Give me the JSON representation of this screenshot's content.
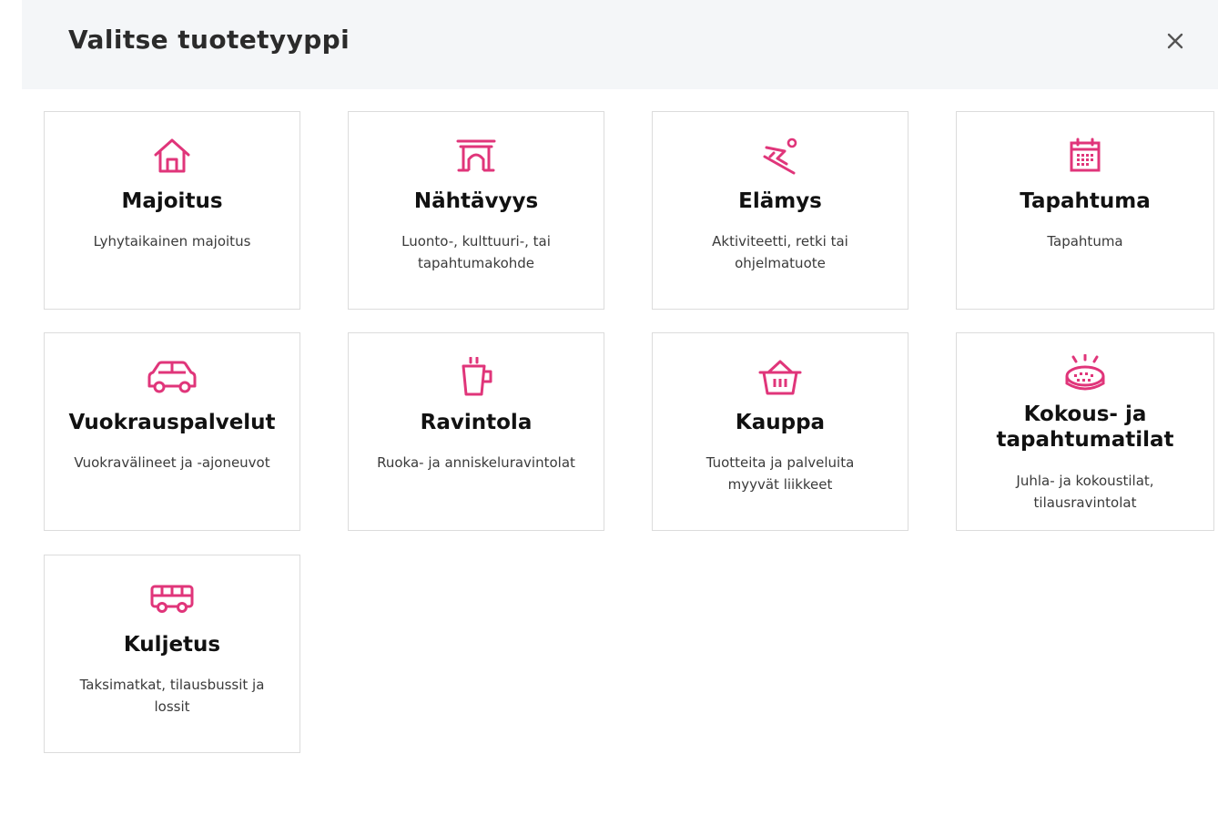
{
  "modal": {
    "title": "Valitse tuotetyyppi"
  },
  "colors": {
    "accent": "#e0357a",
    "header_bg": "#f4f6f8",
    "card_border": "#dcdcdc"
  },
  "cards": [
    {
      "icon": "house-icon",
      "title": "Majoitus",
      "desc": "Lyhytaikainen majoitus"
    },
    {
      "icon": "gate-icon",
      "title": "Nähtävyys",
      "desc": "Luonto-, kulttuuri-, tai tapahtumakohde"
    },
    {
      "icon": "skier-icon",
      "title": "Elämys",
      "desc": "Aktiviteetti, retki tai ohjelmatuote"
    },
    {
      "icon": "calendar-icon",
      "title": "Tapahtuma",
      "desc": "Tapahtuma"
    },
    {
      "icon": "car-icon",
      "title": "Vuokrauspalvelut",
      "desc": "Vuokravälineet ja -ajoneuvot"
    },
    {
      "icon": "coffee-cup-icon",
      "title": "Ravintola",
      "desc": "Ruoka- ja anniskeluravintolat"
    },
    {
      "icon": "shopping-basket-icon",
      "title": "Kauppa",
      "desc": "Tuotteita ja palveluita myyvät liikkeet"
    },
    {
      "icon": "stadium-icon",
      "title": "Kokous- ja tapahtumatilat",
      "desc": "Juhla- ja kokoustilat, tilausravintolat"
    },
    {
      "icon": "bus-icon",
      "title": "Kuljetus",
      "desc": "Taksimatkat, tilausbussit ja lossit"
    }
  ]
}
